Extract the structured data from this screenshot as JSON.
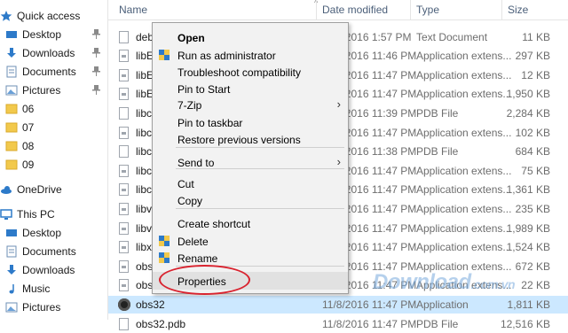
{
  "sidebar": {
    "items": [
      {
        "label": "Quick access",
        "icon": "star-icon",
        "pinned": false
      },
      {
        "label": "Desktop",
        "icon": "desktop-folder-icon",
        "pinned": true
      },
      {
        "label": "Downloads",
        "icon": "download-icon",
        "pinned": true
      },
      {
        "label": "Documents",
        "icon": "documents-icon",
        "pinned": true
      },
      {
        "label": "Pictures",
        "icon": "pictures-icon",
        "pinned": true
      },
      {
        "label": "06",
        "icon": "folder-icon",
        "pinned": false
      },
      {
        "label": "07",
        "icon": "folder-icon",
        "pinned": false
      },
      {
        "label": "08",
        "icon": "folder-icon",
        "pinned": false
      },
      {
        "label": "09",
        "icon": "folder-icon",
        "pinned": false
      },
      {
        "label": "OneDrive",
        "icon": "cloud-icon",
        "pinned": false
      },
      {
        "label": "This PC",
        "icon": "computer-icon",
        "pinned": false
      },
      {
        "label": "Desktop",
        "icon": "desktop-folder-icon",
        "pinned": false
      },
      {
        "label": "Documents",
        "icon": "documents-icon",
        "pinned": false
      },
      {
        "label": "Downloads",
        "icon": "download-icon",
        "pinned": false
      },
      {
        "label": "Music",
        "icon": "music-icon",
        "pinned": false
      },
      {
        "label": "Pictures",
        "icon": "pictures-icon",
        "pinned": false
      }
    ]
  },
  "columns": {
    "name": "Name",
    "date": "Date modified",
    "type": "Type",
    "size": "Size"
  },
  "files": [
    {
      "name": "",
      "date": "",
      "type": "",
      "size": ""
    },
    {
      "name": "deb",
      "date": "11/8/2016 1:57 PM",
      "type": "Text Document",
      "size": "11 KB"
    },
    {
      "name": "libE",
      "date": "11/8/2016 11:46 PM",
      "type": "Application extens...",
      "size": "297 KB"
    },
    {
      "name": "libE",
      "date": "11/8/2016 11:47 PM",
      "type": "Application extens...",
      "size": "12 KB"
    },
    {
      "name": "libE",
      "date": "11/8/2016 11:47 PM",
      "type": "Application extens...",
      "size": "1,950 KB"
    },
    {
      "name": "libc",
      "date": "11/8/2016 11:39 PM",
      "type": "PDB File",
      "size": "2,284 KB"
    },
    {
      "name": "libc",
      "date": "11/8/2016 11:47 PM",
      "type": "Application extens...",
      "size": "102 KB"
    },
    {
      "name": "libc",
      "date": "11/8/2016 11:38 PM",
      "type": "PDB File",
      "size": "684 KB"
    },
    {
      "name": "libc",
      "date": "11/8/2016 11:47 PM",
      "type": "Application extens...",
      "size": "75 KB"
    },
    {
      "name": "libc",
      "date": "11/8/2016 11:47 PM",
      "type": "Application extens...",
      "size": "1,361 KB"
    },
    {
      "name": "libv",
      "date": "11/8/2016 11:47 PM",
      "type": "Application extens...",
      "size": "235 KB"
    },
    {
      "name": "libv",
      "date": "11/8/2016 11:47 PM",
      "type": "Application extens...",
      "size": "1,989 KB"
    },
    {
      "name": "libx",
      "date": "11/8/2016 11:47 PM",
      "type": "Application extens...",
      "size": "1,524 KB"
    },
    {
      "name": "obs",
      "date": "11/8/2016 11:47 PM",
      "type": "Application extens...",
      "size": "672 KB"
    },
    {
      "name": "obs",
      "date": "11/8/2016 11:47 PM",
      "type": "Application extens...",
      "size": "22 KB"
    },
    {
      "name": "obs32",
      "date": "11/8/2016 11:47 PM",
      "type": "Application",
      "size": "1,811 KB"
    },
    {
      "name": "obs32.pdb",
      "date": "11/8/2016 11:47 PM",
      "type": "PDB File",
      "size": "12,516 KB"
    }
  ],
  "context_menu": {
    "items": [
      {
        "label": "Open",
        "bold": true,
        "shield": false,
        "submenu": false
      },
      {
        "label": "Run as administrator",
        "bold": false,
        "shield": true,
        "submenu": false
      },
      {
        "label": "Troubleshoot compatibility",
        "bold": false,
        "shield": false,
        "submenu": false
      },
      {
        "label": "Pin to Start",
        "bold": false,
        "shield": false,
        "submenu": false
      },
      {
        "label": "7-Zip",
        "bold": false,
        "shield": false,
        "submenu": true
      },
      {
        "label": "Pin to taskbar",
        "bold": false,
        "shield": false,
        "submenu": false
      },
      {
        "label": "Restore previous versions",
        "bold": false,
        "shield": false,
        "submenu": false
      },
      {
        "label": "Send to",
        "bold": false,
        "shield": false,
        "submenu": true
      },
      {
        "label": "Cut",
        "bold": false,
        "shield": false,
        "submenu": false
      },
      {
        "label": "Copy",
        "bold": false,
        "shield": false,
        "submenu": false
      },
      {
        "label": "Create shortcut",
        "bold": false,
        "shield": false,
        "submenu": false
      },
      {
        "label": "Delete",
        "bold": false,
        "shield": true,
        "submenu": false
      },
      {
        "label": "Rename",
        "bold": false,
        "shield": true,
        "submenu": false
      },
      {
        "label": "Properties",
        "bold": false,
        "shield": false,
        "submenu": false
      }
    ],
    "highlighted": "Properties"
  },
  "watermark": {
    "text": "Download",
    "suffix": ".com.vn"
  },
  "colors": {
    "selection": "#cce8ff",
    "accent": "#0078d7",
    "highlight_circle": "#d9232f",
    "folder": "#f2c94c"
  }
}
